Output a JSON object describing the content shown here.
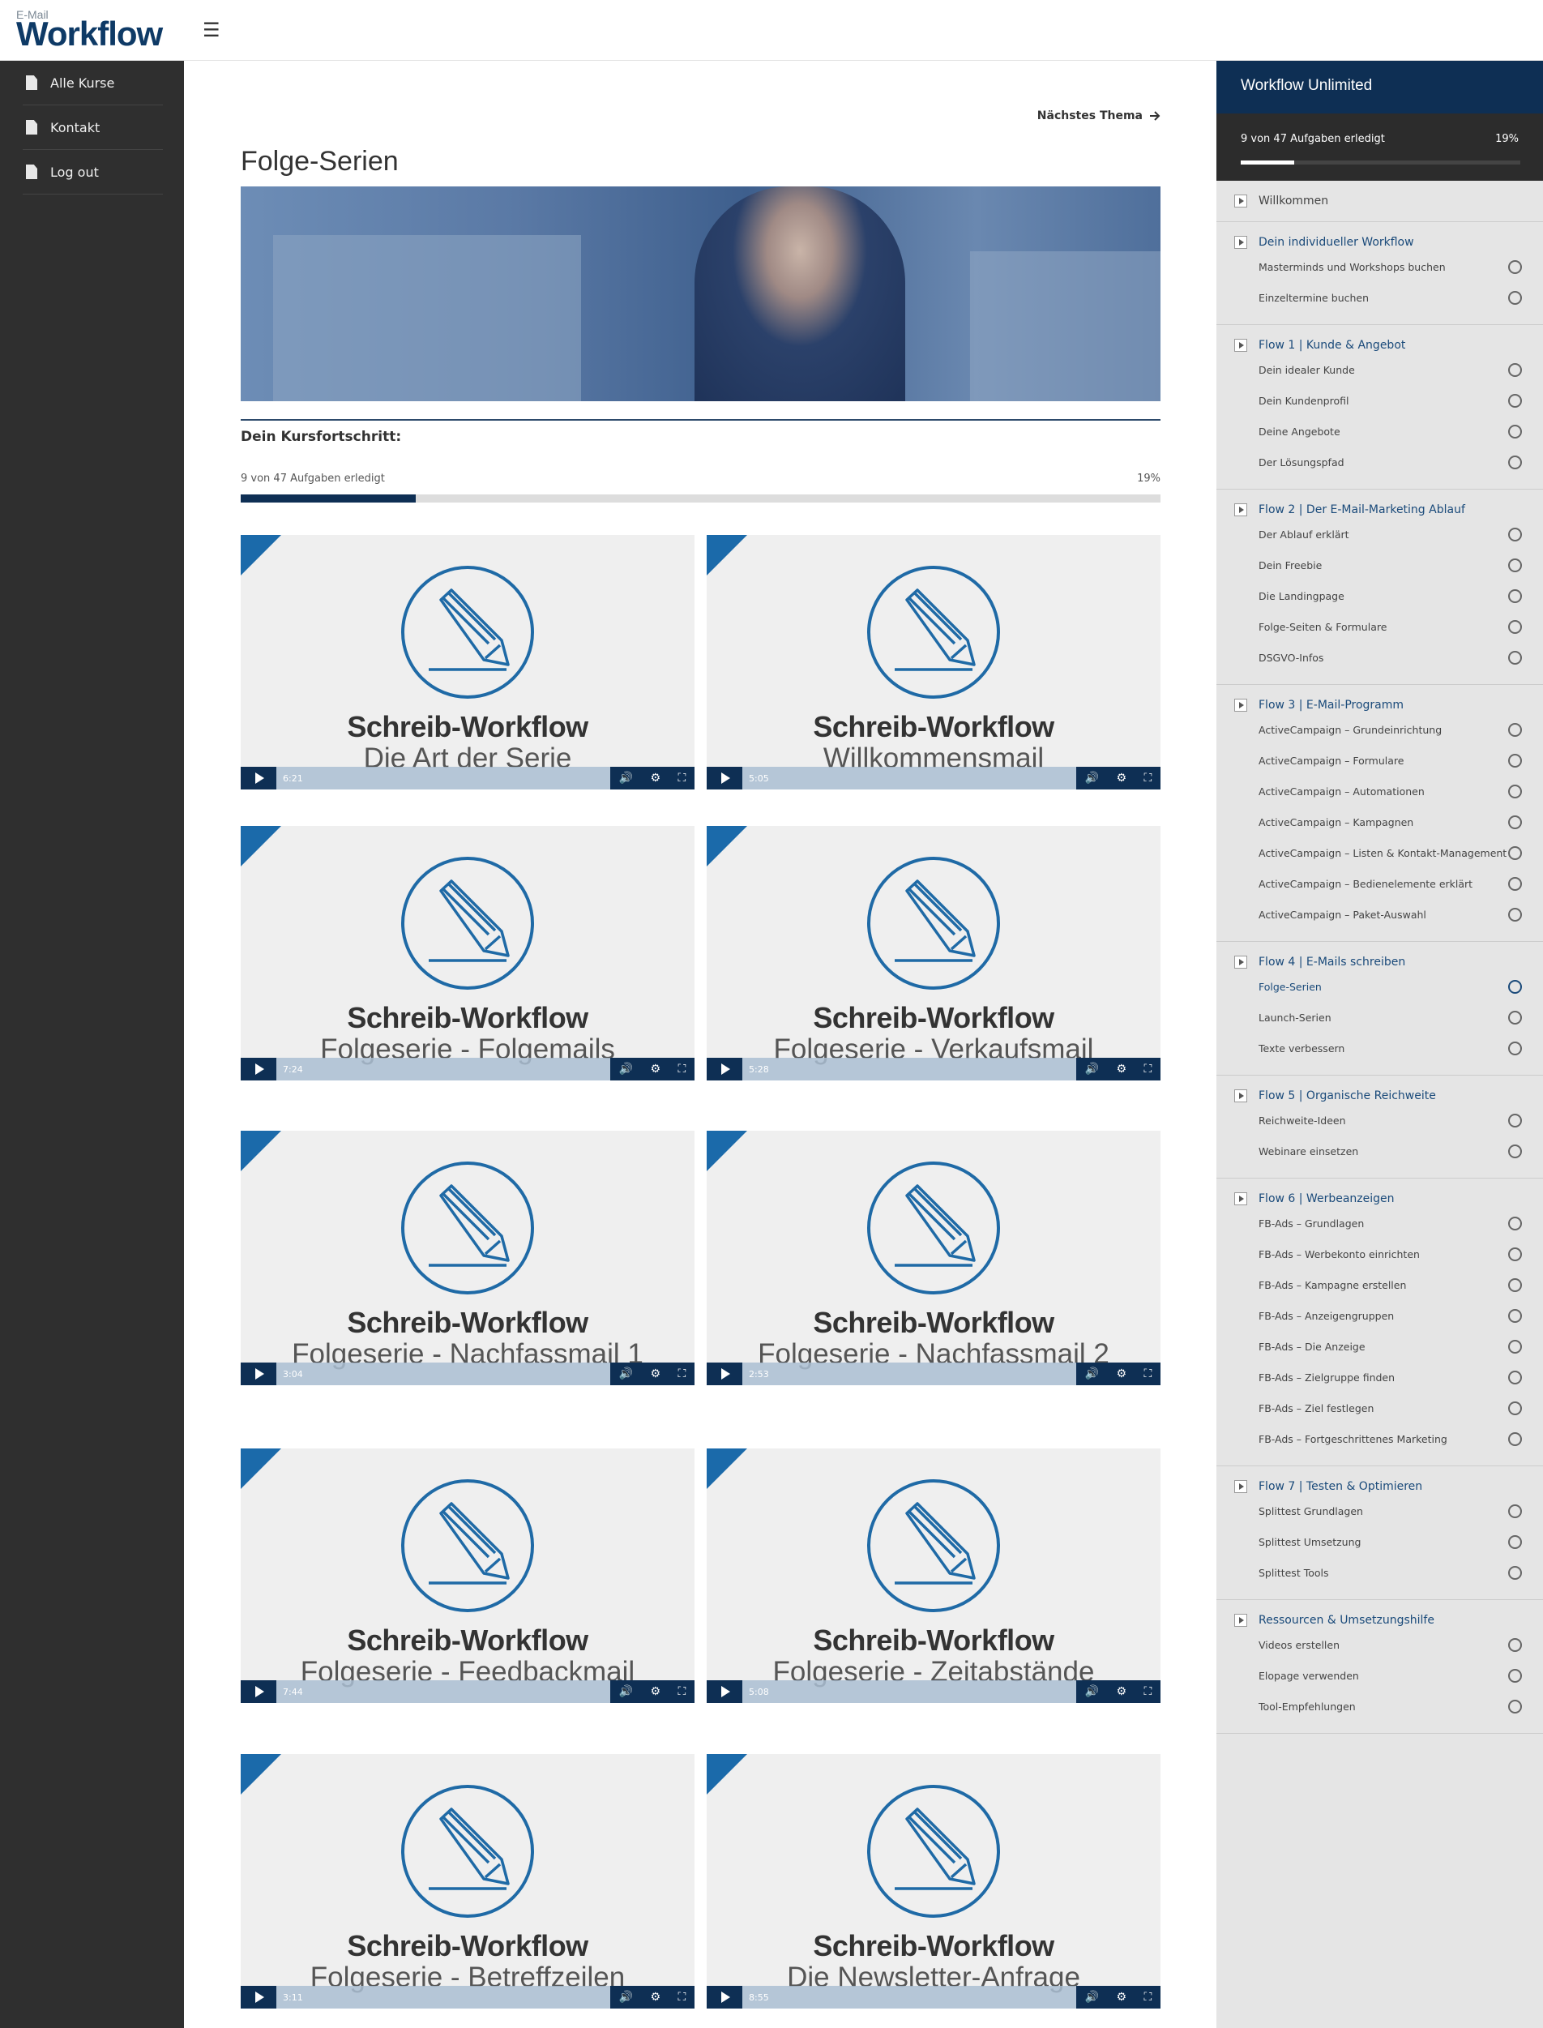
{
  "header": {
    "logo_small": "E-Mail",
    "logo_big": "Workflow",
    "menu_icon": "☰"
  },
  "leftnav": {
    "items": [
      {
        "label": "Alle Kurse"
      },
      {
        "label": "Kontakt"
      },
      {
        "label": "Log out"
      }
    ]
  },
  "main": {
    "next_topic": "Nächstes Thema",
    "title": "Folge-Serien",
    "progress_heading": "Dein Kursfortschritt:",
    "progress_text": "9 von 47 Aufgaben erledigt",
    "progress_pct": "19%",
    "progress_value": 0.19,
    "videos": [
      {
        "t1": "Schreib-Workflow",
        "t2": "Die Art der Serie",
        "dur": "6:21"
      },
      {
        "t1": "Schreib-Workflow",
        "t2": "Willkommensmail",
        "dur": "5:05"
      },
      {
        "t1": "Schreib-Workflow",
        "t2": "Folgeserie - Folgemails",
        "dur": "7:24"
      },
      {
        "t1": "Schreib-Workflow",
        "t2": "Folgeserie - Verkaufsmail",
        "dur": "5:28"
      },
      {
        "t1": "Schreib-Workflow",
        "t2": "Folgeserie - Nachfassmail 1",
        "dur": "3:04"
      },
      {
        "t1": "Schreib-Workflow",
        "t2": "Folgeserie - Nachfassmail 2",
        "dur": "2:53"
      },
      {
        "t1": "Schreib-Workflow",
        "t2": "Folgeserie - Feedbackmail",
        "dur": "7:44"
      },
      {
        "t1": "Schreib-Workflow",
        "t2": "Folgeserie - Zeitabstände",
        "dur": "5:08"
      },
      {
        "t1": "Schreib-Workflow",
        "t2": "Folgeserie - Betreffzeilen",
        "dur": "3:11"
      },
      {
        "t1": "Schreib-Workflow",
        "t2": "Die Newsletter-Anfrage",
        "dur": "8:55"
      }
    ]
  },
  "rsb": {
    "title": "Workflow Unlimited",
    "progress_text": "9 von 47 Aufgaben erledigt",
    "progress_pct": "19%",
    "progress_value": 0.19,
    "sections": [
      {
        "title": "Willkommen",
        "plain": true,
        "lessons": []
      },
      {
        "title": "Dein individueller Workflow",
        "lessons": [
          "Masterminds und Workshops buchen",
          "Einzeltermine buchen"
        ]
      },
      {
        "title": "Flow 1 | Kunde & Angebot",
        "lessons": [
          "Dein idealer Kunde",
          "Dein Kundenprofil",
          "Deine Angebote",
          "Der Lösungspfad"
        ]
      },
      {
        "title": "Flow 2 | Der E-Mail-Marketing Ablauf",
        "lessons": [
          "Der Ablauf erklärt",
          "Dein Freebie",
          "Die Landingpage",
          "Folge-Seiten & Formulare",
          "DSGVO-Infos"
        ]
      },
      {
        "title": "Flow 3 | E-Mail-Programm",
        "lessons": [
          "ActiveCampaign – Grundeinrichtung",
          "ActiveCampaign – Formulare",
          "ActiveCampaign – Automationen",
          "ActiveCampaign – Kampagnen",
          "ActiveCampaign – Listen & Kontakt-Management",
          "ActiveCampaign – Bedienelemente erklärt",
          "ActiveCampaign – Paket-Auswahl"
        ]
      },
      {
        "title": "Flow 4 | E-Mails schreiben",
        "lessons": [
          "Folge-Serien",
          "Launch-Serien",
          "Texte verbessern"
        ],
        "active": 0
      },
      {
        "title": "Flow 5 | Organische Reichweite",
        "lessons": [
          "Reichweite-Ideen",
          "Webinare einsetzen"
        ]
      },
      {
        "title": "Flow 6 | Werbeanzeigen",
        "lessons": [
          "FB-Ads – Grundlagen",
          "FB-Ads – Werbekonto einrichten",
          "FB-Ads – Kampagne erstellen",
          "FB-Ads – Anzeigengruppen",
          "FB-Ads – Die Anzeige",
          "FB-Ads – Zielgruppe finden",
          "FB-Ads – Ziel festlegen",
          "FB-Ads – Fortgeschrittenes Marketing"
        ]
      },
      {
        "title": "Flow 7 | Testen & Optimieren",
        "lessons": [
          "Splittest Grundlagen",
          "Splittest Umsetzung",
          "Splittest Tools"
        ]
      },
      {
        "title": "Ressourcen & Umsetzungshilfe",
        "lessons": [
          "Videos erstellen",
          "Elopage verwenden",
          "Tool-Empfehlungen"
        ]
      }
    ]
  }
}
